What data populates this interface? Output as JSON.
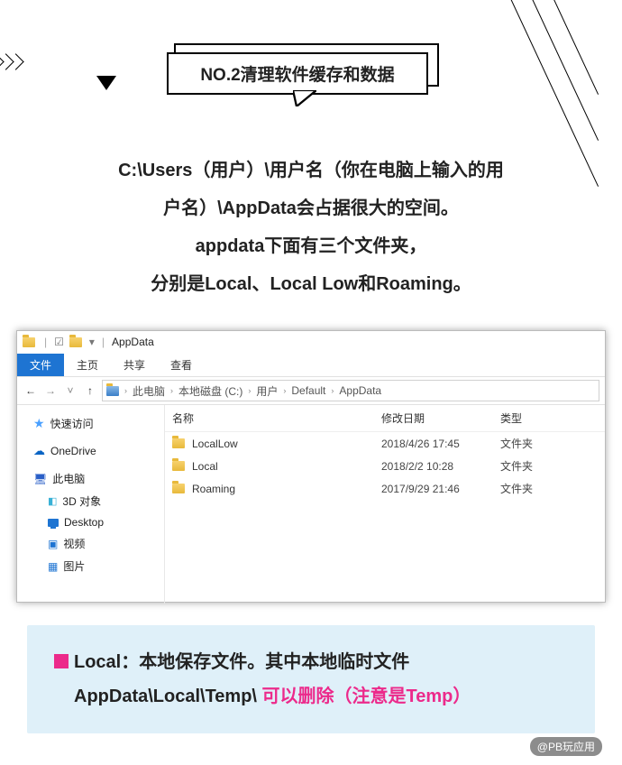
{
  "title": "NO.2清理软件缓存和数据",
  "intro": {
    "line1": "C:\\Users（用户）\\用户名（你在电脑上输入的用",
    "line2": "户名）\\AppData会占据很大的空间。",
    "line3": "appdata下面有三个文件夹，",
    "line4": "分别是Local、Local Low和Roaming。"
  },
  "explorer": {
    "window_title": "AppData",
    "tabs": {
      "file": "文件",
      "home": "主页",
      "share": "共享",
      "view": "查看"
    },
    "breadcrumb": [
      "此电脑",
      "本地磁盘 (C:)",
      "用户",
      "Default",
      "AppData"
    ],
    "sidebar": {
      "quick": "快速访问",
      "onedrive": "OneDrive",
      "thispc": "此电脑",
      "obj3d": "3D 对象",
      "desktop": "Desktop",
      "video": "视频",
      "pictures": "图片"
    },
    "columns": {
      "name": "名称",
      "date": "修改日期",
      "type": "类型"
    },
    "rows": [
      {
        "name": "LocalLow",
        "date": "2018/4/26 17:45",
        "type": "文件夹"
      },
      {
        "name": "Local",
        "date": "2018/2/2 10:28",
        "type": "文件夹"
      },
      {
        "name": "Roaming",
        "date": "2017/9/29 21:46",
        "type": "文件夹"
      }
    ]
  },
  "note": {
    "lead": "Local：",
    "body1": "本地保存文件。其中本地临时文件",
    "body2": "AppData\\Local\\Temp\\ ",
    "hl": "可以删除（注意是Temp）"
  },
  "watermark": "@PB玩应用"
}
